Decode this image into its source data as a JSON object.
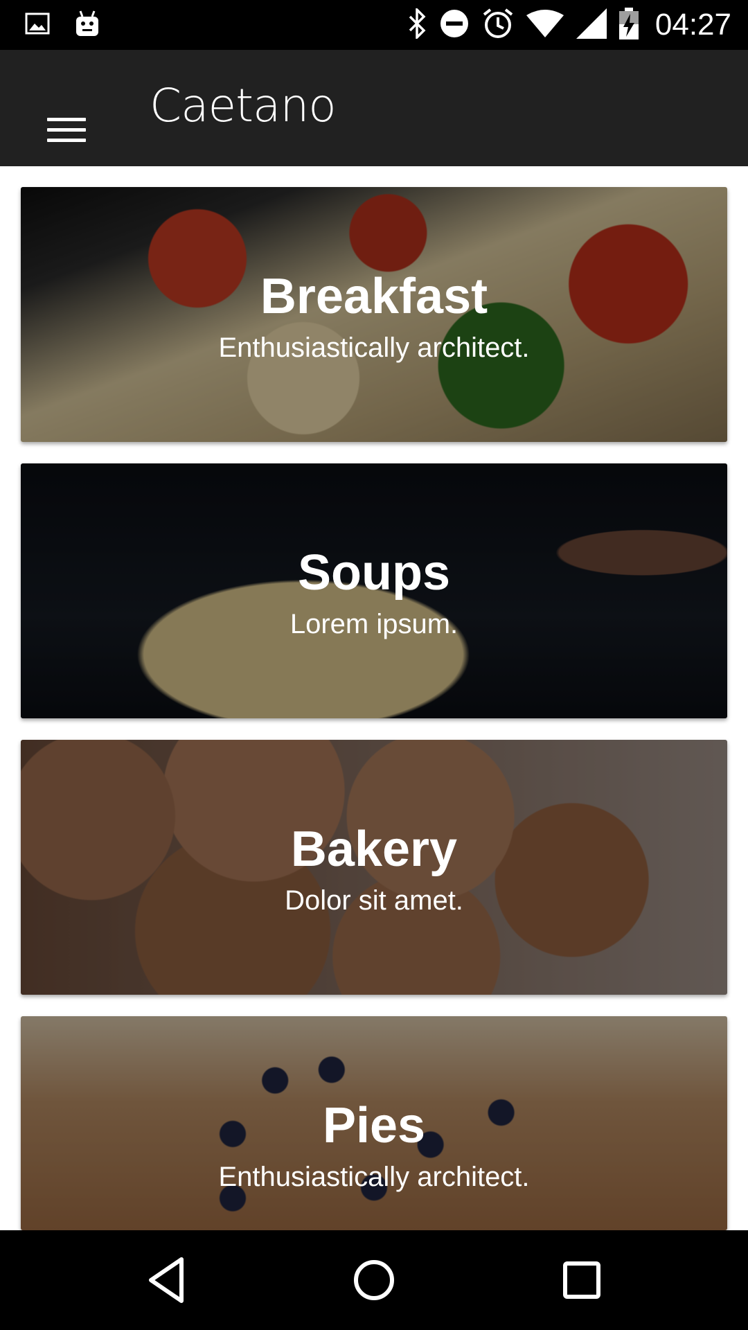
{
  "status_bar": {
    "time": "04:27",
    "left_icons": [
      "image-icon",
      "android-icon"
    ],
    "right_icons": [
      "bluetooth-icon",
      "do-not-disturb-icon",
      "alarm-icon",
      "wifi-icon",
      "signal-icon",
      "battery-charging-icon"
    ]
  },
  "app_bar": {
    "title": "Caetano",
    "menu_icon": "hamburger-menu-icon",
    "background": "#212121"
  },
  "cards": [
    {
      "title": "Breakfast",
      "subtitle": "Enthusiastically architect."
    },
    {
      "title": "Soups",
      "subtitle": "Lorem ipsum."
    },
    {
      "title": "Bakery",
      "subtitle": "Dolor sit amet."
    },
    {
      "title": "Pies",
      "subtitle": "Enthusiastically architect."
    }
  ],
  "nav_bar": {
    "buttons": [
      "back-icon",
      "home-icon",
      "recents-icon"
    ]
  }
}
